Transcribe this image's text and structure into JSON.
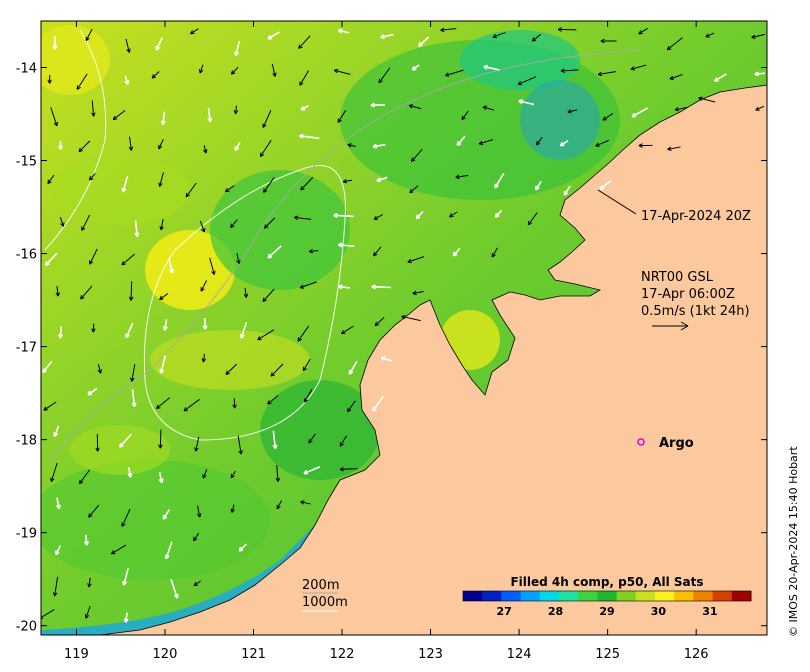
{
  "map": {
    "x_ticks": [
      "119",
      "120",
      "121",
      "122",
      "123",
      "124",
      "125",
      "126"
    ],
    "y_ticks": [
      "-14",
      "-15",
      "-16",
      "-17",
      "-18",
      "-19",
      "-20"
    ],
    "x_range": [
      118.6,
      126.8
    ],
    "y_range": [
      -20.1,
      -13.5
    ],
    "ocean_colors": [
      "#8ccf2a",
      "#3ec53a",
      "#1fb832",
      "#a6dc21",
      "#dbe81c",
      "#f2ec15",
      "#fadc12"
    ],
    "land_color": "#fbc99d"
  },
  "annotations": {
    "pass_time": "17-Apr-2024 20Z",
    "current_source": "NRT00 GSL",
    "current_time": "17-Apr 06:00Z",
    "current_scale": "0.5m/s (1kt 24h)",
    "argo_label": "Argo",
    "contour_200": "200m",
    "contour_1000": "1000m"
  },
  "colorbar": {
    "title": "Filled 4h comp, p50, All Sats",
    "ticks": [
      "27",
      "28",
      "29",
      "30",
      "31"
    ],
    "min": 26.2,
    "max": 31.8,
    "colors": [
      "#00008f",
      "#0020c0",
      "#0060ff",
      "#00a0ff",
      "#00d8e8",
      "#20e0a0",
      "#40d040",
      "#20b830",
      "#80d020",
      "#c8e020",
      "#f8f020",
      "#f8c000",
      "#f08000",
      "#d84000",
      "#a00000"
    ]
  },
  "credit": "© IMOS 20-Apr-2024 15:40 Hobart"
}
